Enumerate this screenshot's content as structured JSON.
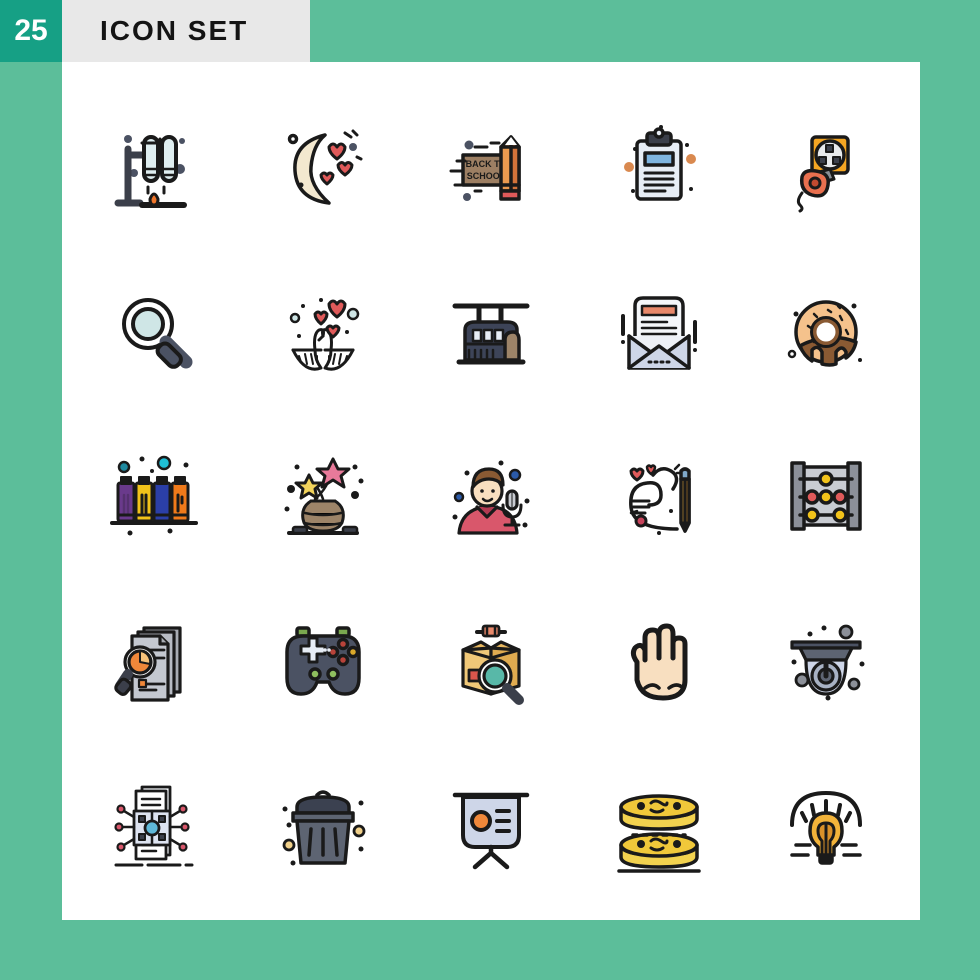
{
  "header": {
    "count": "25",
    "title": "ICON SET"
  },
  "colors": {
    "background_green": "#5cbe9a",
    "badge_green": "#16a085",
    "header_grey": "#e8e8e8",
    "card_white": "#ffffff",
    "outline": "#1a1a1a",
    "accent_orange": "#f39a3e",
    "accent_red": "#e05a5a",
    "accent_blue": "#7fb5e0",
    "accent_yellow": "#f5c842",
    "accent_slate": "#4b5263"
  },
  "icons": [
    {
      "row": 1,
      "col": 1,
      "name": "test-tube-rack-icon",
      "label": "Test Tube Rack"
    },
    {
      "row": 1,
      "col": 2,
      "name": "crescent-moon-hearts-icon",
      "label": "Moon With Hearts"
    },
    {
      "row": 1,
      "col": 3,
      "name": "back-to-school-icon",
      "label": "Back To School",
      "text": "BACK TO\nSCHOOL"
    },
    {
      "row": 1,
      "col": 4,
      "name": "clipboard-icon",
      "label": "Clipboard"
    },
    {
      "row": 1,
      "col": 5,
      "name": "power-socket-plug-icon",
      "label": "Socket And Plug"
    },
    {
      "row": 2,
      "col": 1,
      "name": "magnifying-glass-icon",
      "label": "Search"
    },
    {
      "row": 2,
      "col": 2,
      "name": "love-swans-icon",
      "label": "Love Swans"
    },
    {
      "row": 2,
      "col": 3,
      "name": "cable-car-icon",
      "label": "Cable Car"
    },
    {
      "row": 2,
      "col": 4,
      "name": "open-envelope-icon",
      "label": "Open Mail"
    },
    {
      "row": 2,
      "col": 5,
      "name": "donut-icon",
      "label": "Donut"
    },
    {
      "row": 3,
      "col": 1,
      "name": "paint-bottles-icon",
      "label": "Paint Bottles"
    },
    {
      "row": 3,
      "col": 2,
      "name": "flower-vase-icon",
      "label": "Flower Vase"
    },
    {
      "row": 3,
      "col": 3,
      "name": "podcaster-microphone-icon",
      "label": "Podcaster"
    },
    {
      "row": 3,
      "col": 4,
      "name": "pencil-drawing-heart-icon",
      "label": "Drawing A Heart"
    },
    {
      "row": 3,
      "col": 5,
      "name": "abacus-icon",
      "label": "Abacus"
    },
    {
      "row": 4,
      "col": 1,
      "name": "document-analysis-icon",
      "label": "Data Analysis"
    },
    {
      "row": 4,
      "col": 2,
      "name": "gamepad-icon",
      "label": "Gamepad"
    },
    {
      "row": 4,
      "col": 3,
      "name": "package-search-icon",
      "label": "Package Search"
    },
    {
      "row": 4,
      "col": 4,
      "name": "hand-gesture-icon",
      "label": "Hand Gesture"
    },
    {
      "row": 4,
      "col": 5,
      "name": "dome-security-camera-icon",
      "label": "Security Camera"
    },
    {
      "row": 5,
      "col": 1,
      "name": "network-chip-document-icon",
      "label": "Data Network"
    },
    {
      "row": 5,
      "col": 2,
      "name": "trash-can-icon",
      "label": "Trash Can"
    },
    {
      "row": 5,
      "col": 3,
      "name": "presentation-board-icon",
      "label": "Presentation Board"
    },
    {
      "row": 5,
      "col": 4,
      "name": "coin-stack-icon",
      "label": "Coins"
    },
    {
      "row": 5,
      "col": 5,
      "name": "light-bulb-idea-icon",
      "label": "Idea Bulb"
    }
  ]
}
